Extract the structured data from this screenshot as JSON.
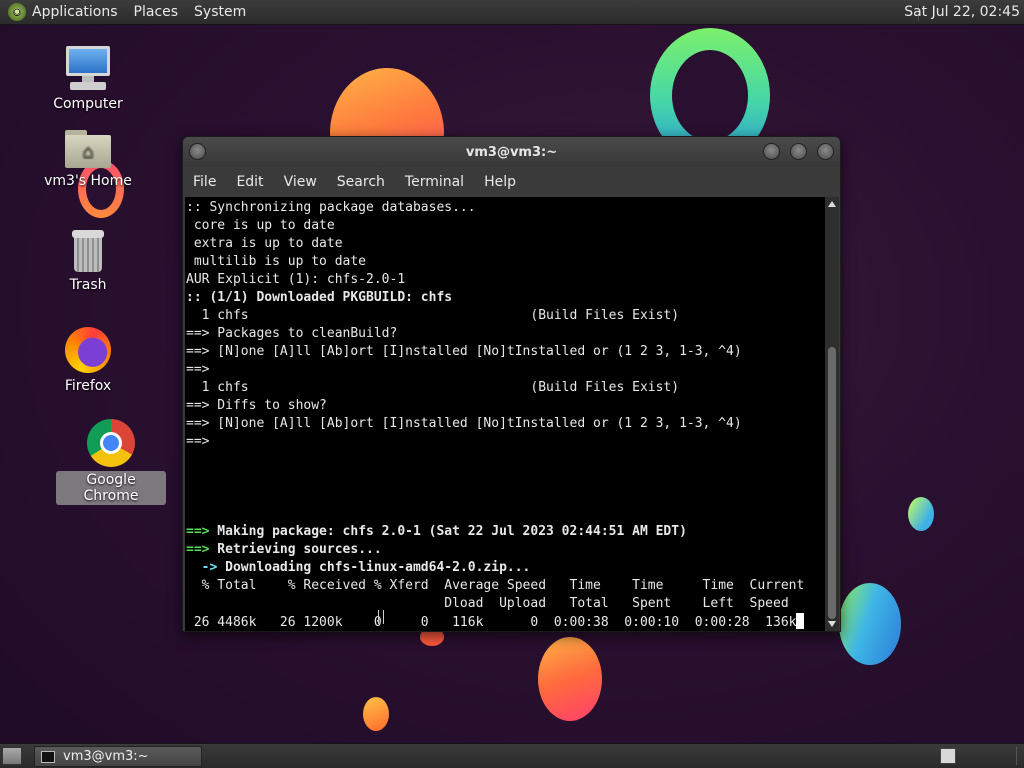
{
  "top_panel": {
    "menus": [
      "Applications",
      "Places",
      "System"
    ],
    "clock": "Sat Jul 22, 02:45"
  },
  "desktop_icons": [
    {
      "label": "Computer"
    },
    {
      "label": "vm3's Home"
    },
    {
      "label": "Trash"
    },
    {
      "label": "Firefox"
    },
    {
      "label": "Google Chrome"
    }
  ],
  "window": {
    "title": "vm3@vm3:~",
    "menu": [
      "File",
      "Edit",
      "View",
      "Search",
      "Terminal",
      "Help"
    ]
  },
  "terminal": {
    "lines": [
      ":: Synchronizing package databases...",
      " core is up to date",
      " extra is up to date",
      " multilib is up to date",
      "AUR Explicit (1): chfs-2.0-1",
      ":: (1/1) Downloaded PKGBUILD: chfs",
      "  1 chfs                                    (Build Files Exist)",
      "==> Packages to cleanBuild?",
      "==> [N]one [A]ll [Ab]ort [I]nstalled [No]tInstalled or (1 2 3, 1-3, ^4)",
      "==>",
      "  1 chfs                                    (Build Files Exist)",
      "==> Diffs to show?",
      "==> [N]one [A]ll [Ab]ort [I]nstalled [No]tInstalled or (1 2 3, 1-3, ^4)",
      "==>",
      "",
      "",
      "",
      "",
      "==> Making package: chfs 2.0-1 (Sat 22 Jul 2023 02:44:51 AM EDT)",
      "==> Retrieving sources...",
      "  -> Downloading chfs-linux-amd64-2.0.zip...",
      "  % Total    % Received % Xferd  Average Speed   Time    Time     Time  Current",
      "                                 Dload  Upload   Total   Spent    Left  Speed",
      " 26 4486k   26 1200k    0     0   116k      0  0:00:38  0:00:10  0:00:28  136k"
    ]
  },
  "taskbar": {
    "task_label": "vm3@vm3:~"
  }
}
